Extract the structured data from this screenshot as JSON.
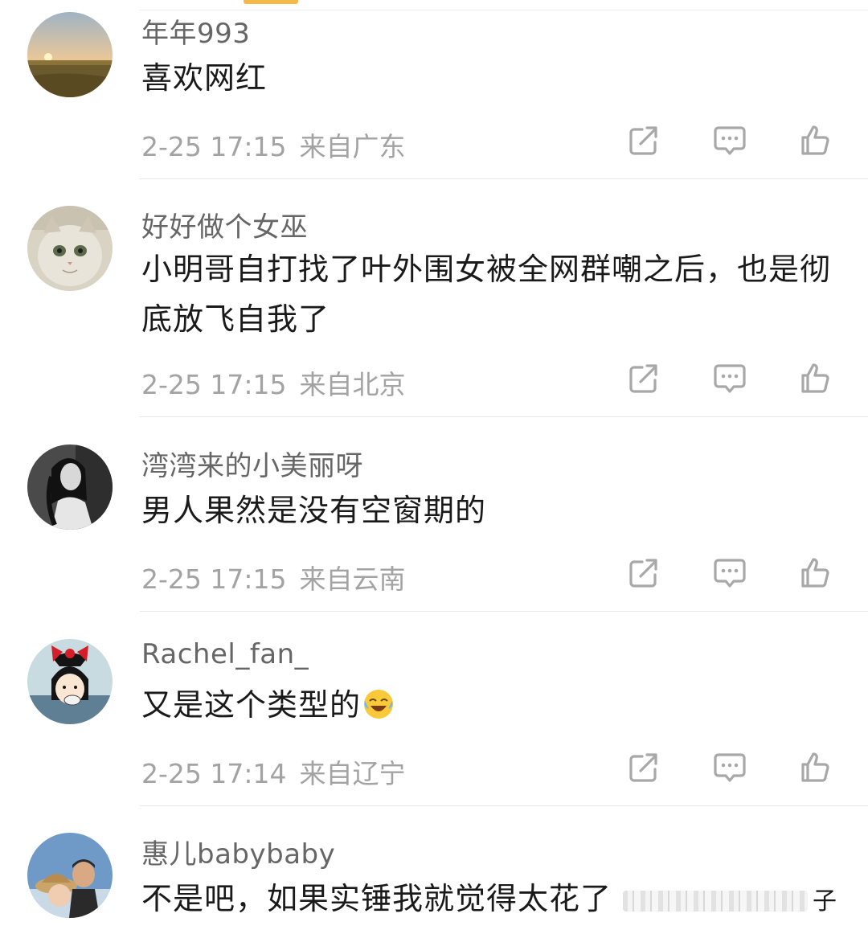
{
  "comments": [
    {
      "username": "年年993",
      "content": "喜欢网红",
      "time": "2-25 17:15",
      "location": "来自广东",
      "avatar": "sunset-field-avatar"
    },
    {
      "username": "好好做个女巫",
      "content": "小明哥自打找了叶外围女被全网群嘲之后，也是彻底放飞自我了",
      "time": "2-25 17:15",
      "location": "来自北京",
      "avatar": "cat-avatar"
    },
    {
      "username": "湾湾来的小美丽呀",
      "content": "男人果然是没有空窗期的",
      "time": "2-25 17:15",
      "location": "来自云南",
      "avatar": "girl-portrait-avatar"
    },
    {
      "username": "Rachel_fan_",
      "content": "又是这个类型的",
      "time": "2-25 17:14",
      "location": "来自辽宁",
      "avatar": "kiki-avatar",
      "emoji": "laughing-crying-emoji"
    },
    {
      "username": "惠儿babybaby",
      "content": "不是吧，如果实锤我就觉得太花了",
      "trailing_text": "子",
      "avatar": "couple-avatar"
    }
  ],
  "actions": {
    "share_icon": "share-icon",
    "reply_icon": "comment-icon",
    "like_icon": "thumbs-up-icon"
  },
  "colors": {
    "username": "#666666",
    "content": "#1a1a1a",
    "meta": "#a3a3a3",
    "icon": "#a8a8a8",
    "accent": "#f5b94a"
  }
}
